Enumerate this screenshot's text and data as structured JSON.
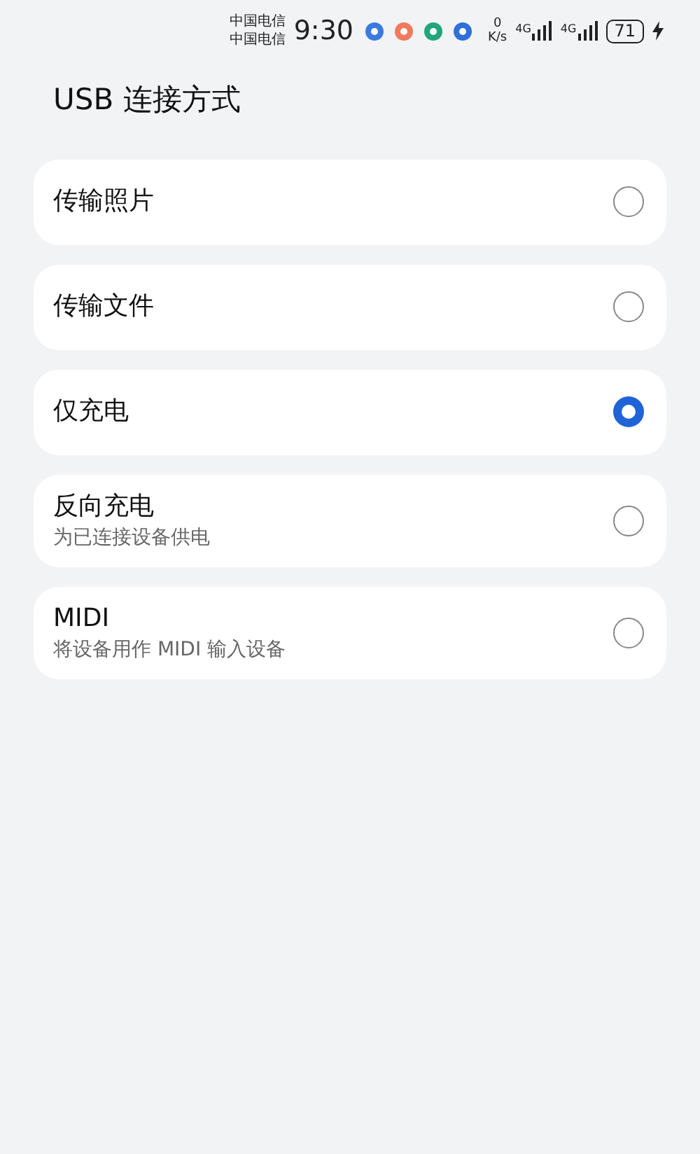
{
  "status_bar": {
    "carriers": [
      "中国电信",
      "中国电信"
    ],
    "time": "9:30",
    "speed_value": "0",
    "speed_unit": "K/s",
    "networks": [
      "4G",
      "4G"
    ],
    "battery": "71",
    "charging": true
  },
  "title": "USB 连接方式",
  "options": [
    {
      "label": "传输照片",
      "selected": false
    },
    {
      "label": "传输文件",
      "selected": false
    },
    {
      "label": "仅充电",
      "selected": true
    },
    {
      "label": "反向充电",
      "description": "为已连接设备供电",
      "selected": false
    },
    {
      "label": "MIDI",
      "description": "将设备用作 MIDI 输入设备",
      "selected": false
    }
  ]
}
